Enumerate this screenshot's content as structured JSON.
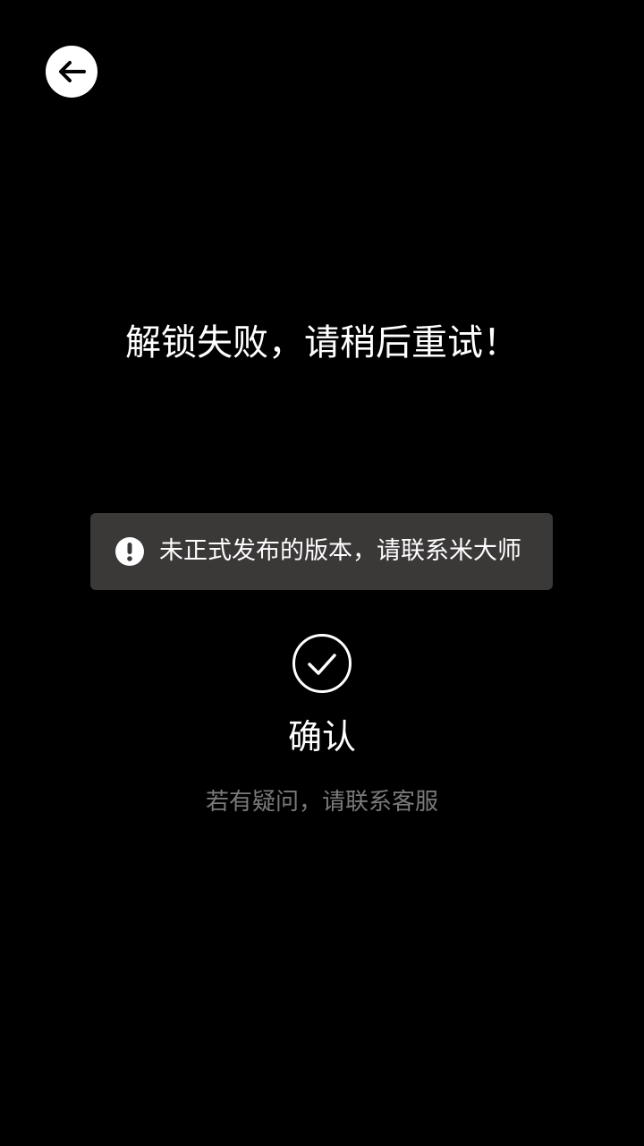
{
  "header": {
    "back_icon": "arrow-left-icon"
  },
  "main": {
    "title": "解锁失败，请稍后重试！",
    "toast": {
      "icon": "exclamation-circle-icon",
      "message": "未正式发布的版本，请联系米大师"
    },
    "confirm": {
      "icon": "check-circle-icon",
      "label": "确认"
    },
    "help_text": "若有疑问，请联系客服"
  },
  "colors": {
    "background": "#000000",
    "toast_background": "#3b3838",
    "primary_text": "#ffffff",
    "secondary_text": "#7a7a7a"
  }
}
